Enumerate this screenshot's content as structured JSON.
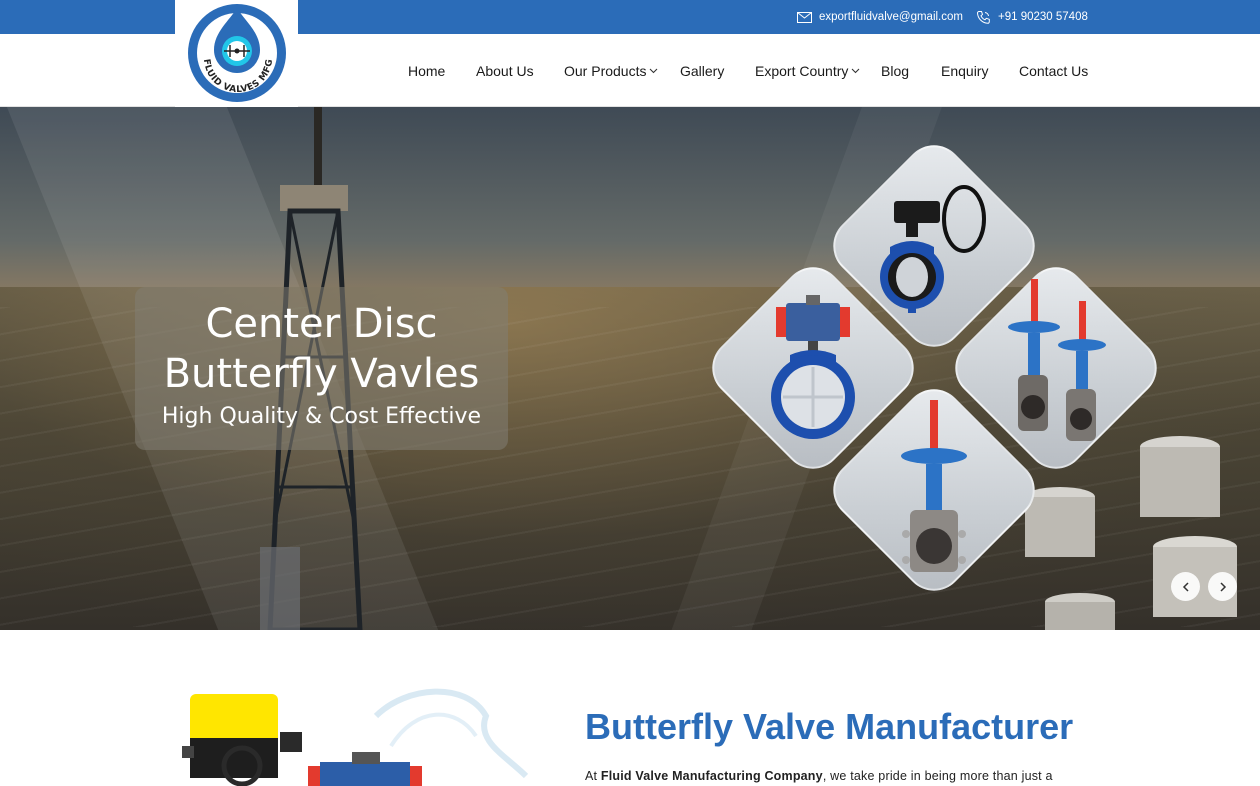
{
  "topbar": {
    "email": "exportfluidvalve@gmail.com",
    "phone": "+91 90230 57408",
    "icons": {
      "email": "mail-icon",
      "phone": "phone-icon"
    }
  },
  "logo": {
    "text": "FLUID VALVES MFG"
  },
  "nav": {
    "items": [
      {
        "label": "Home"
      },
      {
        "label": "About Us"
      },
      {
        "label": "Our Products",
        "has_dropdown": true
      },
      {
        "label": "Gallery"
      },
      {
        "label": "Export Country",
        "has_dropdown": true
      },
      {
        "label": "Blog"
      },
      {
        "label": "Enquiry"
      },
      {
        "label": "Contact Us"
      }
    ]
  },
  "hero": {
    "line1": "Center Disc",
    "line2": "Butterfly Vavles",
    "line3": "High Quality & Cost Effective",
    "prev_icon": "chevron-left-icon",
    "next_icon": "chevron-right-icon"
  },
  "intro": {
    "title": "Butterfly Valve Manufacturer",
    "text_prefix": "At ",
    "company": "Fluid Valve Manufacturing Company",
    "text_suffix": ", we take pride in being more than just a"
  },
  "colors": {
    "brand_blue": "#2b6cb8",
    "valve_red": "#e33a2e",
    "valve_blue": "#1d4fae"
  }
}
